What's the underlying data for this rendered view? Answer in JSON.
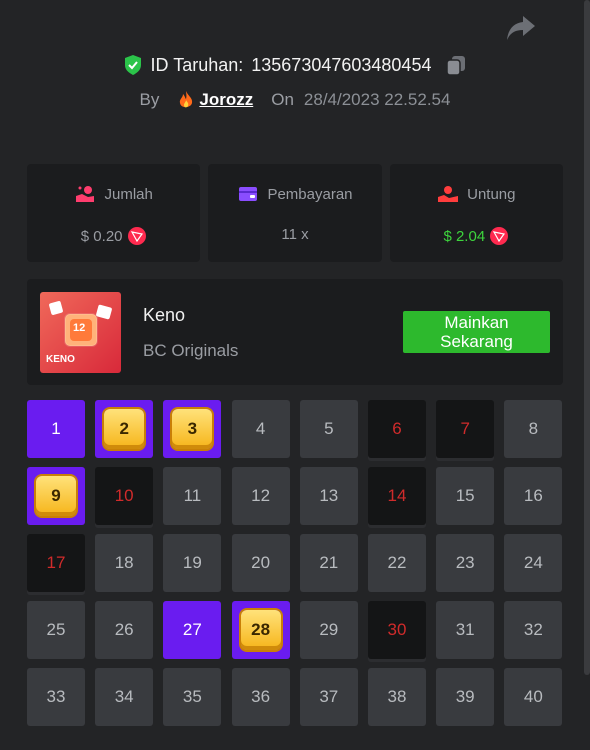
{
  "header": {
    "bet_id_label": "ID Taruhan:",
    "bet_id": "135673047603480454",
    "by_label": "By",
    "user": "Jorozz",
    "on_label": "On",
    "date": "28/4/2023 22.52.54"
  },
  "stats": [
    {
      "label": "Jumlah",
      "value": "$ 0.20",
      "icon": "coins-icon",
      "color": "#9a9da3"
    },
    {
      "label": "Pembayaran",
      "value": "11 x",
      "icon": "card-icon",
      "color": "#9a9da3"
    },
    {
      "label": "Untung",
      "value": "$ 2.04",
      "icon": "profit-icon",
      "color": "#3dd43d"
    }
  ],
  "game": {
    "name": "Keno",
    "provider": "BC Originals",
    "thumb_label": "KENO",
    "thumb_number": "12",
    "play_label_1": "Mainkan",
    "play_label_2": "Sekarang"
  },
  "grid": {
    "numbers": [
      "1",
      "2",
      "3",
      "4",
      "5",
      "6",
      "7",
      "8",
      "9",
      "10",
      "11",
      "12",
      "13",
      "14",
      "15",
      "16",
      "17",
      "18",
      "19",
      "20",
      "21",
      "22",
      "23",
      "24",
      "25",
      "26",
      "27",
      "28",
      "29",
      "30",
      "31",
      "32",
      "33",
      "34",
      "35",
      "36",
      "37",
      "38",
      "39",
      "40"
    ],
    "states": [
      "picked",
      "hit",
      "hit",
      "normal",
      "normal",
      "drawn",
      "drawn",
      "normal",
      "hit",
      "drawn",
      "normal",
      "normal",
      "normal",
      "drawn",
      "normal",
      "normal",
      "drawn",
      "normal",
      "normal",
      "normal",
      "normal",
      "normal",
      "normal",
      "normal",
      "normal",
      "normal",
      "picked",
      "hit",
      "normal",
      "drawn",
      "normal",
      "normal",
      "normal",
      "normal",
      "normal",
      "normal",
      "normal",
      "normal",
      "normal",
      "normal"
    ]
  }
}
